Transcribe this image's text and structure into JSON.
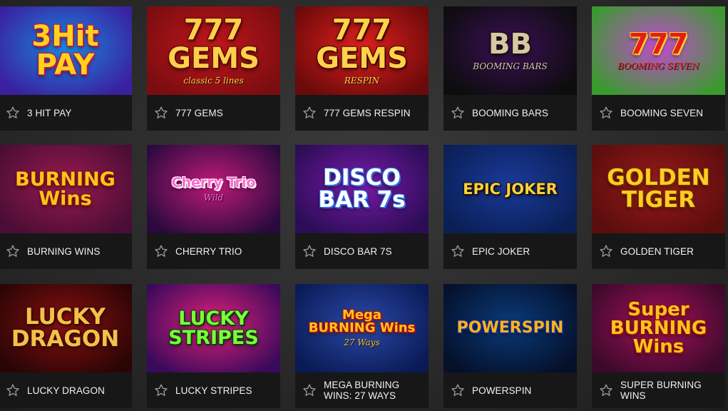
{
  "games": [
    {
      "title": "3 HIT PAY",
      "art": "3Hit\nPAY",
      "art_sub": "",
      "bg": [
        "#3a1f9e",
        "#1b86e0"
      ],
      "art_color": "#ffd21e",
      "art_stroke": "#c0134a"
    },
    {
      "title": "777 GEMS",
      "art": "777\nGEMS",
      "art_sub": "classic 5 lines",
      "bg": [
        "#7a0d10",
        "#c0161b"
      ],
      "art_color": "#ffcf4a",
      "art_stroke": "#5a0808"
    },
    {
      "title": "777 GEMS RESPIN",
      "art": "777\nGEMS",
      "art_sub": "RESPIN",
      "bg": [
        "#6b0a0a",
        "#e0201e"
      ],
      "art_color": "#ffd24a",
      "art_stroke": "#4a0505"
    },
    {
      "title": "BOOMING BARS",
      "art": "BB",
      "art_sub": "BOOMING  BARS",
      "bg": [
        "#0d0d0d",
        "#3a0e55"
      ],
      "art_color": "#d8c7a0",
      "art_stroke": "#111111"
    },
    {
      "title": "BOOMING SEVEN",
      "art": "777",
      "art_sub": "BOOMING  SEVEN",
      "bg": [
        "#3a9a2e",
        "#c24ad0"
      ],
      "art_color": "#e61c1c",
      "art_stroke": "#ffd21e"
    },
    {
      "title": "BURNING WINS",
      "art": "BURNING\nWins",
      "art_sub": "",
      "bg": [
        "#4a0d35",
        "#9a1a50"
      ],
      "art_color": "#ffc21e",
      "art_stroke": "#7a1010"
    },
    {
      "title": "CHERRY TRIO",
      "art": "Cherry Trio",
      "art_sub": "Wild",
      "bg": [
        "#2a0a3e",
        "#c01a7a"
      ],
      "art_color": "#ff6ad0",
      "art_stroke": "#ffffff"
    },
    {
      "title": "DISCO BAR 7S",
      "art": "DISCO\nBAR 7s",
      "art_sub": "",
      "bg": [
        "#2a0d55",
        "#7a1aa8"
      ],
      "art_color": "#ffffff",
      "art_stroke": "#2a6ee0"
    },
    {
      "title": "EPIC JOKER",
      "art": "EPIC JOKER",
      "art_sub": "",
      "bg": [
        "#0a1f55",
        "#1a3a9a"
      ],
      "art_color": "#ffcf3a",
      "art_stroke": "#111111"
    },
    {
      "title": "GOLDEN TIGER",
      "art": "GOLDEN\nTIGER",
      "art_sub": "",
      "bg": [
        "#5a0d0d",
        "#9a1a1a"
      ],
      "art_color": "#ffcc22",
      "art_stroke": "#6a2a00"
    },
    {
      "title": "LUCKY DRAGON",
      "art": "LUCKY\nDRAGON",
      "art_sub": "",
      "bg": [
        "#2a0505",
        "#8a1010"
      ],
      "art_color": "#f5c04a",
      "art_stroke": "#3a0a00"
    },
    {
      "title": "LUCKY STRIPES",
      "art": "LUCKY\nSTRIPES",
      "art_sub": "",
      "bg": [
        "#3a0a5a",
        "#e0207a"
      ],
      "art_color": "#7aff3a",
      "art_stroke": "#0a3a0a"
    },
    {
      "title": "MEGA BURNING WINS: 27 WAYS",
      "art": "Mega\nBURNING Wins",
      "art_sub": "27 Ways",
      "bg": [
        "#0a1a55",
        "#2a4aa8"
      ],
      "art_color": "#ffc21e",
      "art_stroke": "#a81010"
    },
    {
      "title": "POWERSPIN",
      "art": "POWERSPIN",
      "art_sub": "",
      "bg": [
        "#05102a",
        "#0a3a7a"
      ],
      "art_color": "#ffb21e",
      "art_stroke": "#0a2a8a"
    },
    {
      "title": "SUPER BURNING WINS",
      "art": "Super\nBURNING\nWins",
      "art_sub": "",
      "bg": [
        "#3a0a2a",
        "#a8105a"
      ],
      "art_color": "#ffc21e",
      "art_stroke": "#8a1010"
    }
  ]
}
